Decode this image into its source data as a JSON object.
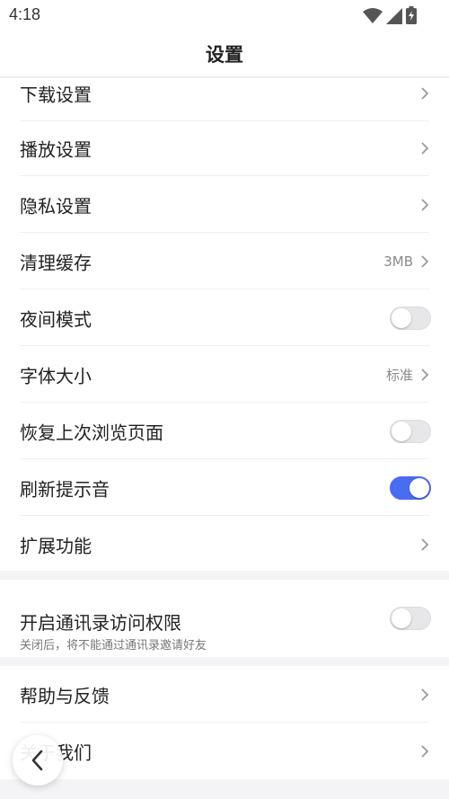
{
  "status_bar": {
    "time": "4:18",
    "icons": [
      "wifi-icon",
      "cellular-signal-icon",
      "battery-charging-icon"
    ]
  },
  "header": {
    "title": "设置"
  },
  "group1": {
    "items": [
      {
        "label": "下载设置",
        "type": "link"
      },
      {
        "label": "播放设置",
        "type": "link"
      },
      {
        "label": "隐私设置",
        "type": "link"
      },
      {
        "label": "清理缓存",
        "type": "link",
        "value": "3MB"
      },
      {
        "label": "夜间模式",
        "type": "toggle",
        "on": false
      },
      {
        "label": "字体大小",
        "type": "link",
        "value": "标准"
      },
      {
        "label": "恢复上次浏览页面",
        "type": "toggle",
        "on": false
      },
      {
        "label": "刷新提示音",
        "type": "toggle",
        "on": true
      },
      {
        "label": "扩展功能",
        "type": "link"
      }
    ]
  },
  "group2": {
    "label": "开启通讯录访问权限",
    "sublabel": "关闭后，将不能通过通讯录邀请好友",
    "on": false
  },
  "group3": {
    "items": [
      {
        "label": "帮助与反馈",
        "type": "link"
      },
      {
        "label": "关于我们",
        "type": "link"
      }
    ]
  },
  "colors": {
    "accent": "#4a6cf0",
    "background": "#f4f4f6",
    "card": "#ffffff"
  },
  "floating": {
    "icon": "back-arrow-icon"
  }
}
